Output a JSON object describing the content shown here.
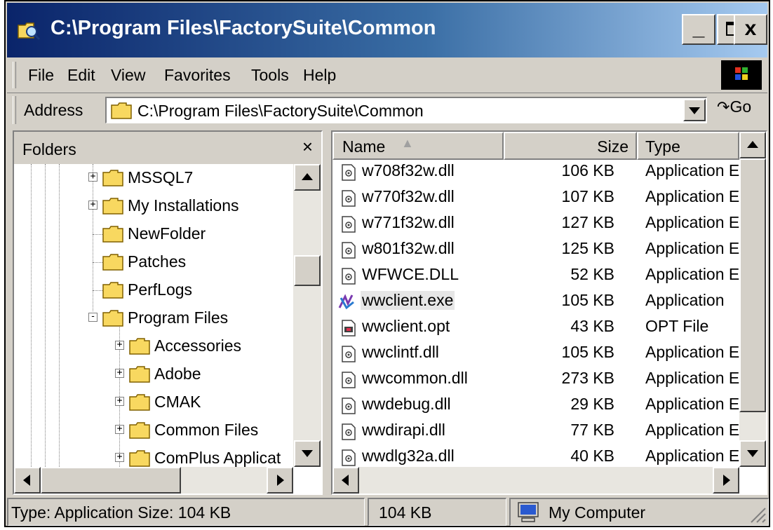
{
  "window": {
    "title": "C:\\Program Files\\FactorySuite\\Common",
    "controls": {
      "minimize": "_",
      "maximize": "□",
      "close": "x"
    }
  },
  "menubar": {
    "items": [
      "File",
      "Edit",
      "View",
      "Favorites",
      "Tools",
      "Help"
    ]
  },
  "address": {
    "label": "Address",
    "value": "C:\\Program Files\\FactorySuite\\Common",
    "go_label": "Go"
  },
  "folders": {
    "title": "Folders",
    "close": "×",
    "items": [
      {
        "label": "MSSQL7",
        "expander": "+"
      },
      {
        "label": "My Installations",
        "expander": "+"
      },
      {
        "label": "NewFolder",
        "expander": ""
      },
      {
        "label": "Patches",
        "expander": ""
      },
      {
        "label": "PerfLogs",
        "expander": ""
      },
      {
        "label": "Program Files",
        "expander": "-"
      },
      {
        "label": "Accessories",
        "expander": "+"
      },
      {
        "label": "Adobe",
        "expander": "+"
      },
      {
        "label": "CMAK",
        "expander": "+"
      },
      {
        "label": "Common Files",
        "expander": "+"
      },
      {
        "label": "ComPlus Applicat",
        "expander": "+"
      }
    ]
  },
  "files": {
    "columns": {
      "name": "Name",
      "size": "Size",
      "type": "Type"
    },
    "rows": [
      {
        "name": "w708f32w.dll",
        "size": "106 KB",
        "type": "Application E",
        "icon": "dll-icon"
      },
      {
        "name": "w770f32w.dll",
        "size": "107 KB",
        "type": "Application E",
        "icon": "dll-icon"
      },
      {
        "name": "w771f32w.dll",
        "size": "127 KB",
        "type": "Application E",
        "icon": "dll-icon"
      },
      {
        "name": "w801f32w.dll",
        "size": "125 KB",
        "type": "Application E",
        "icon": "dll-icon"
      },
      {
        "name": "WFWCE.DLL",
        "size": "52 KB",
        "type": "Application E",
        "icon": "dll-icon"
      },
      {
        "name": "wwclient.exe",
        "size": "105 KB",
        "type": "Application",
        "icon": "exe-icon",
        "selected": true
      },
      {
        "name": "wwclient.opt",
        "size": "43 KB",
        "type": "OPT File",
        "icon": "opt-file-icon"
      },
      {
        "name": "wwclintf.dll",
        "size": "105 KB",
        "type": "Application E",
        "icon": "dll-icon"
      },
      {
        "name": "wwcommon.dll",
        "size": "273 KB",
        "type": "Application E",
        "icon": "dll-icon"
      },
      {
        "name": "wwdebug.dll",
        "size": "29 KB",
        "type": "Application E",
        "icon": "dll-icon"
      },
      {
        "name": "wwdirapi.dll",
        "size": "77 KB",
        "type": "Application E",
        "icon": "dll-icon"
      },
      {
        "name": "wwdlg32a.dll",
        "size": "40 KB",
        "type": "Application E",
        "icon": "dll-icon"
      }
    ]
  },
  "statusbar": {
    "info": "Type: Application Size: 104 KB",
    "size": "104 KB",
    "zone": "My Computer"
  },
  "colors": {
    "title_start": "#0a246a",
    "title_end": "#a6caf0",
    "face": "#d4d0c8",
    "folder_yellow": "#f8d860"
  }
}
